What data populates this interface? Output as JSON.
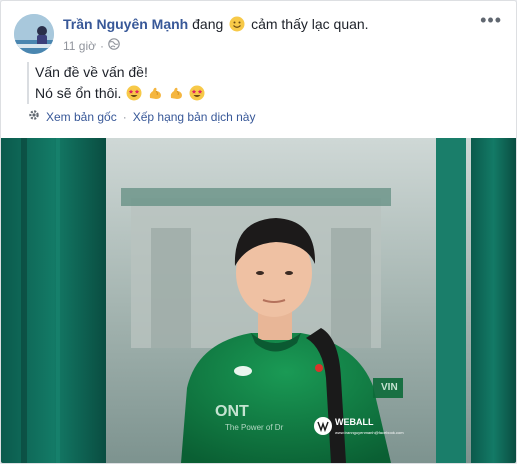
{
  "post": {
    "author": "Trần Nguyên Mạnh",
    "feeling_prefix": "đang",
    "feeling_text": "cảm thấy lạc quan.",
    "timestamp": "11 giờ",
    "text_line1": "Vấn đề về vấn đề!",
    "text_line2": "Nó sẽ ổn thôi."
  },
  "translation": {
    "see_original": "Xem bản gốc",
    "separator": "·",
    "rate_translation": "Xếp hạng bản dịch này"
  },
  "photo": {
    "shirt_text": "ONT",
    "shirt_subtext": "The Power of Dr",
    "sleeve_text": "VIN",
    "watermark": "WEBALL",
    "watermark_sub": "www.trannguyenmanh@facebook.com"
  },
  "icons": [
    "globe-icon",
    "gear-icon",
    "more-icon",
    "smiley-emoji",
    "star-struck-emoji",
    "flexed-biceps-emoji"
  ]
}
